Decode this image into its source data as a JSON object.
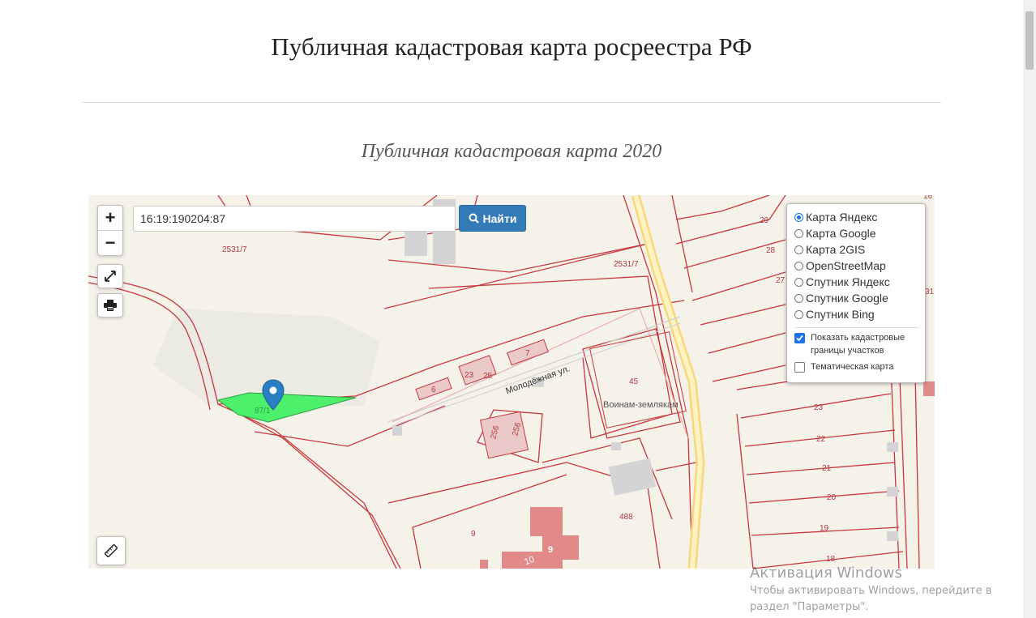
{
  "page": {
    "title": "Публичная кадастровая карта росреестра РФ",
    "subtitle": "Публичная кадастровая карта 2020"
  },
  "map": {
    "zoom_in": "+",
    "zoom_out": "−",
    "search_value": "16:19:190204:87",
    "find_label": "Найти",
    "labels": {
      "parcel_2531_a": "2531/7",
      "parcel_2531_b": "2531/7",
      "parcel_87": "87/1",
      "street": "Молодёжная ул.",
      "b6": "6",
      "b23": "23",
      "b25": "25",
      "b7": "7",
      "b45": "45",
      "monument": "Воинам-землякам",
      "b256a": "256",
      "b256b": "256",
      "b488": "488",
      "b9": "9",
      "b10": "10",
      "b9b": "9",
      "n29": "29",
      "n28": "28",
      "n27": "27",
      "n31": "31",
      "n23": "23",
      "n22": "22",
      "n21": "21",
      "n20": "20",
      "n19": "19",
      "n18": "18",
      "n16": "16"
    },
    "marker_color": "#2a7ec2",
    "highlight_color": "#4cf06a",
    "parcel_line_color": "#c8363c"
  },
  "layers": {
    "options": [
      {
        "label": "Карта Яндекс",
        "selected": true
      },
      {
        "label": "Карта Google",
        "selected": false
      },
      {
        "label": "Карта 2GIS",
        "selected": false
      },
      {
        "label": "OpenStreetMap",
        "selected": false
      },
      {
        "label": "Спутник Яндекс",
        "selected": false
      },
      {
        "label": "Спутник Google",
        "selected": false
      },
      {
        "label": "Спутник Bing",
        "selected": false
      }
    ],
    "show_cadastral": {
      "label": "Показать кадастровые границы участков",
      "checked": true
    },
    "thematic": {
      "label": "Тематическая карта",
      "checked": false
    }
  },
  "activation": {
    "title": "Активация Windows",
    "text": "Чтобы активировать Windows, перейдите в раздел \"Параметры\"."
  }
}
